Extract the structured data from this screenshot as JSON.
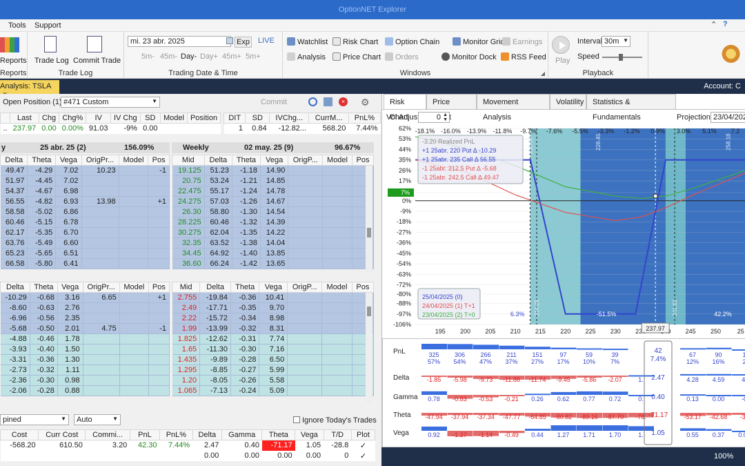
{
  "window": {
    "title": "OptionNET Explorer"
  },
  "menu": [
    "Tools",
    "Support"
  ],
  "ribbon": {
    "reports": {
      "btn": "Reports",
      "group": "Reports"
    },
    "tradelog": {
      "b1": "Trade Log",
      "b2": "Commit Trade",
      "group": "Trade Log"
    },
    "trading": {
      "date": "mi. 23 abr. 2025",
      "exp": "Exp",
      "live": "LIVE",
      "steps": [
        "5m-",
        "45m-",
        "Day-",
        "Day+",
        "45m+",
        "5m+"
      ],
      "group": "Trading Date & Time"
    },
    "windows": {
      "items": [
        "Watchlist",
        "Risk Chart",
        "Option Chain",
        "Monitor Grid",
        "Earnings",
        "Analysis",
        "Price Chart",
        "Orders",
        "Monitor Dock",
        "RSS Feed"
      ],
      "group": "Windows"
    },
    "playback": {
      "play": "Play",
      "interval_label": "Interval",
      "interval": "30m",
      "speed": "Speed",
      "group": "Playback"
    }
  },
  "doc_tab": {
    "label": "Analysis: TSLA",
    "close": "×"
  },
  "account": {
    "label": "Account: C"
  },
  "position": {
    "label": "Open Position (1)",
    "selector": "#471 Custom",
    "commit": "Commit"
  },
  "summary": {
    "headers": [
      "Last",
      "Chg",
      "Chg%",
      "IV",
      "IV Chg",
      "SD",
      "Model",
      "Position"
    ],
    "values": [
      "237.97",
      "0.00",
      "0.00%",
      "91.03",
      "-9%",
      "0.00",
      "",
      ""
    ],
    "headers2": [
      "DIT",
      "SD",
      "IVChg...",
      "CurrM...",
      "PnL%"
    ],
    "values2": [
      "1",
      "0.84",
      "-12.82...",
      "568.20",
      "7.44%"
    ]
  },
  "exp_left": {
    "name": "y",
    "date": "25 abr. 25 (2)",
    "iv": "156.09%"
  },
  "exp_right": {
    "name": "Weekly",
    "date": "02 may. 25 (9)",
    "iv": "96.67%"
  },
  "calls_left_headers": [
    "Delta",
    "Theta",
    "Vega",
    "OrigPr...",
    "Model",
    "Pos"
  ],
  "calls_left": [
    [
      "49.47",
      "-4.29",
      "7.02",
      "10.23",
      "",
      "-1"
    ],
    [
      "51.97",
      "-4.45",
      "7.02",
      "",
      "",
      ""
    ],
    [
      "54.37",
      "-4.67",
      "6.98",
      "",
      "",
      ""
    ],
    [
      "56.55",
      "-4.82",
      "6.93",
      "13.98",
      "",
      "+1"
    ],
    [
      "58.58",
      "-5.02",
      "6.86",
      "",
      "",
      ""
    ],
    [
      "60.46",
      "-5.15",
      "6.78",
      "",
      "",
      ""
    ],
    [
      "62.17",
      "-5.35",
      "6.70",
      "",
      "",
      ""
    ],
    [
      "63.76",
      "-5.49",
      "6.60",
      "",
      "",
      ""
    ],
    [
      "65.23",
      "-5.65",
      "6.51",
      "",
      "",
      ""
    ],
    [
      "66.58",
      "-5.80",
      "6.41",
      "",
      "",
      ""
    ]
  ],
  "calls_right_headers": [
    "Mid",
    "Delta",
    "Theta",
    "Vega",
    "OrigP...",
    "Model",
    "Pos"
  ],
  "calls_right": [
    [
      "19.125",
      "51.23",
      "-1.18",
      "14.90"
    ],
    [
      "20.75",
      "53.24",
      "-1.21",
      "14.85"
    ],
    [
      "22.475",
      "55.17",
      "-1.24",
      "14.78"
    ],
    [
      "24.275",
      "57.03",
      "-1.26",
      "14.67"
    ],
    [
      "26.30",
      "58.80",
      "-1.30",
      "14.54"
    ],
    [
      "28.225",
      "60.46",
      "-1.32",
      "14.39"
    ],
    [
      "30.275",
      "62.04",
      "-1.35",
      "14.22"
    ],
    [
      "32.35",
      "63.52",
      "-1.38",
      "14.04"
    ],
    [
      "34.45",
      "64.92",
      "-1.40",
      "13.85"
    ],
    [
      "36.60",
      "66.24",
      "-1.42",
      "13.65"
    ]
  ],
  "puts_left_headers": [
    "Delta",
    "Theta",
    "Vega",
    "OrigPr...",
    "Model",
    "Pos"
  ],
  "puts_left": [
    [
      "-10.29",
      "-0.68",
      "3.16",
      "6.65",
      "",
      "+1"
    ],
    [
      "-8.60",
      "-0.63",
      "2.76",
      "",
      "",
      ""
    ],
    [
      "-6.96",
      "-0.56",
      "2.35",
      "",
      "",
      ""
    ],
    [
      "-5.68",
      "-0.50",
      "2.01",
      "4.75",
      "",
      "-1"
    ],
    [
      "-4.88",
      "-0.46",
      "1.78",
      "",
      "",
      ""
    ],
    [
      "-3.93",
      "-0.40",
      "1.50",
      "",
      "",
      ""
    ],
    [
      "-3.31",
      "-0.36",
      "1.30",
      "",
      "",
      ""
    ],
    [
      "-2.73",
      "-0.32",
      "1.11",
      "",
      "",
      ""
    ],
    [
      "-2.36",
      "-0.30",
      "0.98",
      "",
      "",
      ""
    ],
    [
      "-2.06",
      "-0.28",
      "0.88",
      "",
      "",
      ""
    ]
  ],
  "puts_right_headers": [
    "Mid",
    "Delta",
    "Theta",
    "Vega",
    "OrigP...",
    "Model",
    "Pos"
  ],
  "puts_right": [
    [
      "2.755",
      "-19.84",
      "-0.36",
      "10.41"
    ],
    [
      "2.49",
      "-17.71",
      "-0.35",
      "9.70"
    ],
    [
      "2.22",
      "-15.72",
      "-0.34",
      "8.98"
    ],
    [
      "1.99",
      "-13.99",
      "-0.32",
      "8.31"
    ],
    [
      "1.825",
      "-12.62",
      "-0.31",
      "7.74"
    ],
    [
      "1.65",
      "-11.30",
      "-0.30",
      "7.16"
    ],
    [
      "1.435",
      "-9.89",
      "-0.28",
      "6.50"
    ],
    [
      "1.295",
      "-8.85",
      "-0.27",
      "5.99"
    ],
    [
      "1.20",
      "-8.05",
      "-0.26",
      "5.58"
    ],
    [
      "1.065",
      "-7.13",
      "-0.24",
      "5.09"
    ]
  ],
  "bottom": {
    "combo": "pined",
    "auto": "Auto",
    "ignore": "Ignore Today's Trades",
    "headers": [
      "Cost",
      "Curr Cost",
      "Commi...",
      "PnL",
      "PnL%",
      "Delta",
      "Gamma",
      "Theta",
      "Vega",
      "T/D",
      "Plot"
    ],
    "row1": [
      "-568.20",
      "610.50",
      "3.20",
      "42.30",
      "7.44%",
      "2.47",
      "0.40",
      "-71.17",
      "1.05",
      "-28.8",
      "✓"
    ],
    "row2": [
      "",
      "",
      "",
      "",
      "",
      "0.00",
      "0.00",
      "0.00",
      "0.00",
      "0",
      "✓"
    ]
  },
  "right_tabs": [
    "Risk Chart",
    "Price Chart",
    "Movement Analysis",
    "Volatility",
    "Statistics & Fundamentals"
  ],
  "vol_adjust": {
    "label": "Vol Adjust",
    "value": "0"
  },
  "projection": {
    "label": "Projection",
    "value": "23/04/2025"
  },
  "legend": {
    "items": [
      "-3.20 Realized PnL",
      "+1 25abr. 220 Put Δ  -10.29",
      "+1 25abr. 235 Call Δ  56.55",
      "-1 25abr. 212.5 Put Δ  -5.68",
      "-1 25abr. 242.5 Call Δ  49.47"
    ],
    "dates": [
      "25/04/2025 (0)",
      "24/04/2025 (1) T+1",
      "23/04/2025 (2) T+0"
    ]
  },
  "chart_data": {
    "type": "line",
    "top_axis": [
      "-18.1%",
      "-16.0%",
      "-13.9%",
      "-11.8%",
      "-9.7%",
      "-7.6%",
      "-5.5%",
      "-3.3%",
      "-1.2%",
      "0.9%",
      "3.0%",
      "5.1%",
      "7.2"
    ],
    "y_ticks": [
      "62%",
      "53%",
      "44%",
      "35%",
      "26%",
      "17%",
      "7%",
      "0%",
      "-9%",
      "-18%",
      "-27%",
      "-36%",
      "-45%",
      "-54%",
      "-63%",
      "-72%",
      "-80%",
      "-88%",
      "-97%",
      "-106%"
    ],
    "x_ticks": [
      "195",
      "200",
      "205",
      "210",
      "215",
      "220",
      "225",
      "230",
      "235",
      "240",
      "245",
      "250",
      "25"
    ],
    "xlim": [
      190,
      256
    ],
    "ylim": [
      -106,
      62
    ],
    "current_price": "237.97",
    "current_pnl": "7%",
    "strike_labels": [
      "212.93",
      "214.25",
      "228.45",
      "241.82",
      "258.18"
    ],
    "zone_labels": [
      "-51.5%",
      "42.2%",
      "6.3%"
    ],
    "series": [
      {
        "name": "25/04/2025 (0)",
        "color": "#3344cc",
        "x": [
          190,
          213,
          220,
          234,
          240,
          244,
          256
        ],
        "y": [
          35,
          35,
          -97,
          -97,
          35,
          35,
          35
        ]
      },
      {
        "name": "24/04/2025 (1) T+1",
        "color": "#e05050",
        "x": [
          190,
          200,
          210,
          220,
          230,
          235,
          240,
          245,
          256
        ],
        "y": [
          35,
          25,
          5,
          -10,
          -17,
          -14,
          -6,
          4,
          24
        ]
      },
      {
        "name": "23/04/2025 (2) T+0",
        "color": "#40b040",
        "x": [
          190,
          200,
          210,
          220,
          230,
          235,
          240,
          245,
          256
        ],
        "y": [
          55,
          45,
          30,
          12,
          4,
          2,
          4,
          10,
          26
        ]
      }
    ]
  },
  "greeks": {
    "rows": [
      {
        "label": "PnL",
        "vals": [
          "325",
          "306",
          "266",
          "211",
          "151",
          "97",
          "59",
          "39",
          "",
          "",
          "67",
          "90",
          "1"
        ],
        "pct": [
          "57%",
          "54%",
          "47%",
          "37%",
          "27%",
          "17%",
          "10%",
          "7%",
          "",
          "",
          "12%",
          "16%",
          "2"
        ],
        "current": "42",
        "current2": "7.4%"
      },
      {
        "label": "Delta",
        "vals": [
          "-1.85",
          "-5.98",
          "-9.73",
          "-11.88",
          "-11.74",
          "-9.45",
          "-5.86",
          "-2.07",
          "1.",
          "",
          "4.28",
          "4.59",
          "4."
        ],
        "current": "2.47"
      },
      {
        "label": "Gamma",
        "vals": [
          "0.78",
          "-0.83",
          "-0.53",
          "-0.21",
          "0.26",
          "0.62",
          "0.77",
          "0.72",
          "0.",
          "",
          "0.13",
          "0.00",
          "-0"
        ],
        "current": "0.40"
      },
      {
        "label": "Theta",
        "vals": [
          "-47.94",
          "-37.94",
          "-37.34",
          "-47.77",
          "-64.85",
          "-80.82",
          "-89.16",
          "-87.70",
          "-78.",
          "",
          "-53.17",
          "-42.68",
          "-34"
        ],
        "current": "-71.17"
      },
      {
        "label": "Vega",
        "vals": [
          "0.92",
          "-1.27",
          "-1.14",
          "-0.49",
          "0.44",
          "1.27",
          "1.71",
          "1.70",
          "1.",
          "",
          "0.55",
          "0.37",
          "0.01"
        ],
        "current": "1.05"
      }
    ]
  },
  "zoom": "100%"
}
